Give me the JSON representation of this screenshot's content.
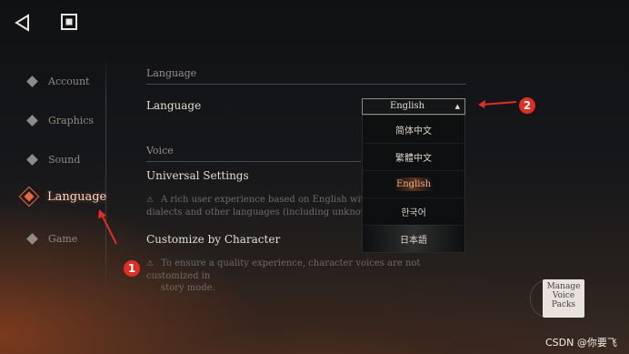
{
  "toolbar": {
    "back_icon": "back-triangle-icon",
    "stop_icon": "stop-square-icon"
  },
  "sidebar": {
    "items": [
      {
        "label": "Account"
      },
      {
        "label": "Graphics"
      },
      {
        "label": "Sound"
      },
      {
        "label": "Language",
        "active": true
      },
      {
        "label": "Game"
      }
    ]
  },
  "language_section": {
    "heading": "Language",
    "row_label": "Language",
    "dropdown_value": "English",
    "options": [
      "简体中文",
      "繁體中文",
      "English",
      "한국어",
      "日本語"
    ],
    "selected": "English"
  },
  "voice_section": {
    "heading": "Voice",
    "universal_label": "Universal Settings",
    "universal_note_line1": "A rich user experience based on English with a mo",
    "universal_note_line2": "dialects and other languages (including unknown",
    "customize_label": "Customize by Character",
    "customize_note_line1": "To ensure a quality experience, character voices are not customized in",
    "customize_note_line2": "story mode."
  },
  "manage_button": {
    "line1": "Manage",
    "line2": "Voice",
    "line3": "Packs"
  },
  "annotations": {
    "badge1": "1",
    "badge2": "2",
    "color": "#e02e24"
  },
  "watermark": "CSDN @你要飞"
}
